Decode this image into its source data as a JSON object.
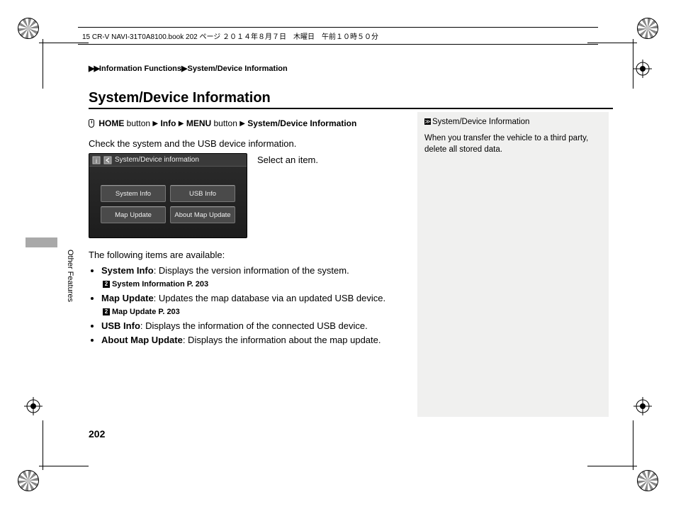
{
  "meta_line": "15 CR-V NAVI-31T0A8100.book  202 ページ  ２０１４年８月７日　木曜日　午前１０時５０分",
  "breadcrumb": {
    "arrows": "▶▶",
    "part1": "Information Functions",
    "sep": "▶",
    "part2": "System/Device Information"
  },
  "title": "System/Device Information",
  "nav_path": {
    "home_bold": "HOME",
    "home_rest": " button",
    "info": "Info",
    "menu_bold": "MENU",
    "menu_rest": " button",
    "dest": "System/Device Information"
  },
  "intro": "Check the system and the USB device information.",
  "select_item": "Select an item.",
  "device_screen": {
    "header": "System/Device information",
    "buttons": [
      "System Info",
      "USB Info",
      "Map Update",
      "About Map Update"
    ]
  },
  "following": "The following items are available:",
  "items": [
    {
      "name": "System Info",
      "desc": ": Displays the version information of the system.",
      "xref": "System Information",
      "xref_page": "P. 203"
    },
    {
      "name": "Map Update",
      "desc": ": Updates the map database via an updated USB device.",
      "xref": "Map Update",
      "xref_page": "P. 203"
    },
    {
      "name": "USB Info",
      "desc": ": Displays the information of the connected USB device."
    },
    {
      "name": "About Map Update",
      "desc": ": Displays the information about the map update."
    }
  ],
  "right_block": {
    "title": "System/Device Information",
    "body": "When you transfer the vehicle to a third party, delete all stored data."
  },
  "side_label": "Other Features",
  "page_number": "202"
}
